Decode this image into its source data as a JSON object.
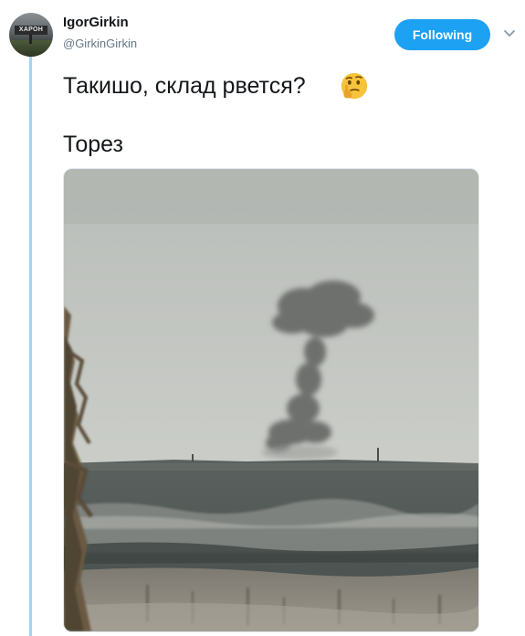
{
  "tweet": {
    "user": {
      "name": "IgorGirkin",
      "handle": "@GirkinGirkin",
      "avatar_sign_text": "ХАРОН"
    },
    "follow_label": "Following",
    "menu_icon": "chevron-down-icon",
    "text_line1": "Такишо, склад рвется?",
    "text_line2": "Торез",
    "emoji": "thinking-face",
    "colors": {
      "accent": "#1da1f2",
      "thread_line": "#a3d4f5",
      "handle": "#657786"
    }
  }
}
